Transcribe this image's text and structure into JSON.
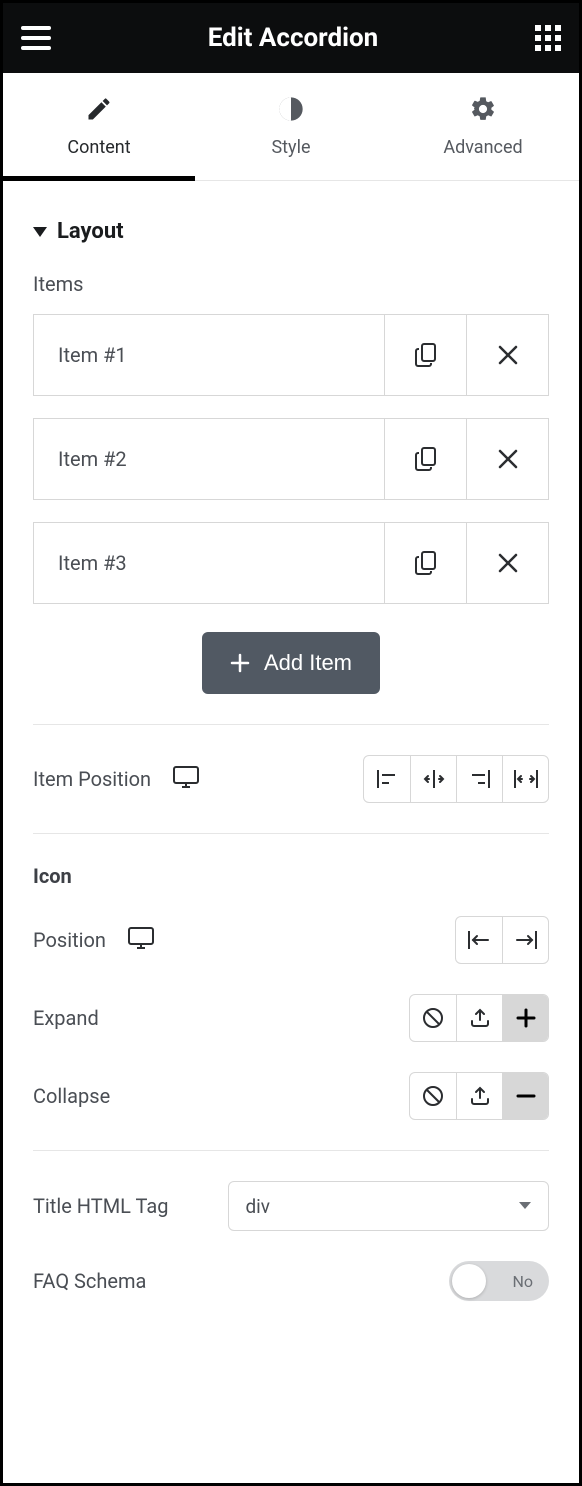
{
  "header": {
    "title": "Edit Accordion"
  },
  "tabs": {
    "content": "Content",
    "style": "Style",
    "advanced": "Advanced"
  },
  "layout": {
    "section_title": "Layout",
    "items_label": "Items",
    "items": [
      {
        "label": "Item #1"
      },
      {
        "label": "Item #2"
      },
      {
        "label": "Item #3"
      }
    ],
    "add_item": "Add Item",
    "item_position_label": "Item Position"
  },
  "icon": {
    "heading": "Icon",
    "position_label": "Position",
    "expand_label": "Expand",
    "collapse_label": "Collapse"
  },
  "title_html_tag": {
    "label": "Title HTML Tag",
    "value": "div"
  },
  "faq_schema": {
    "label": "FAQ Schema",
    "value": "No"
  }
}
